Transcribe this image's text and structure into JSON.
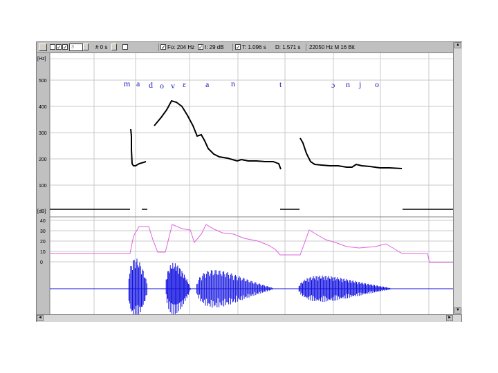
{
  "toolbar": {
    "field_value": "3",
    "time_step": "# 0 s",
    "fo": "Fo: 204 Hz",
    "intensity": "I: 29 dB",
    "time": "T: 1.096 s",
    "duration": "D: 1.571 s",
    "format": "22050 Hz  M  16 Bit"
  },
  "f0_panel": {
    "unit": "[Hz]",
    "ticks": [
      "500",
      "400",
      "300",
      "200",
      "100"
    ]
  },
  "intensity_panel": {
    "unit": "[dB]",
    "ticks": [
      "40",
      "30",
      "20",
      "10",
      "0"
    ]
  },
  "transcription": [
    "m",
    "a",
    "d",
    "o",
    "v",
    "ɛ",
    "a",
    "n",
    "t",
    "ɔ",
    "n",
    "j",
    "o"
  ],
  "colors": {
    "pitch": "#000000",
    "intensity": "#e060e0",
    "waveform": "#1010e0",
    "transcription": "#2020c0",
    "grid": "#c8c8c8",
    "background": "#c0c0c0"
  },
  "icons": {
    "scroll_up": "▲",
    "scroll_down": "▼",
    "scroll_left": "◄",
    "scroll_right": "►"
  }
}
